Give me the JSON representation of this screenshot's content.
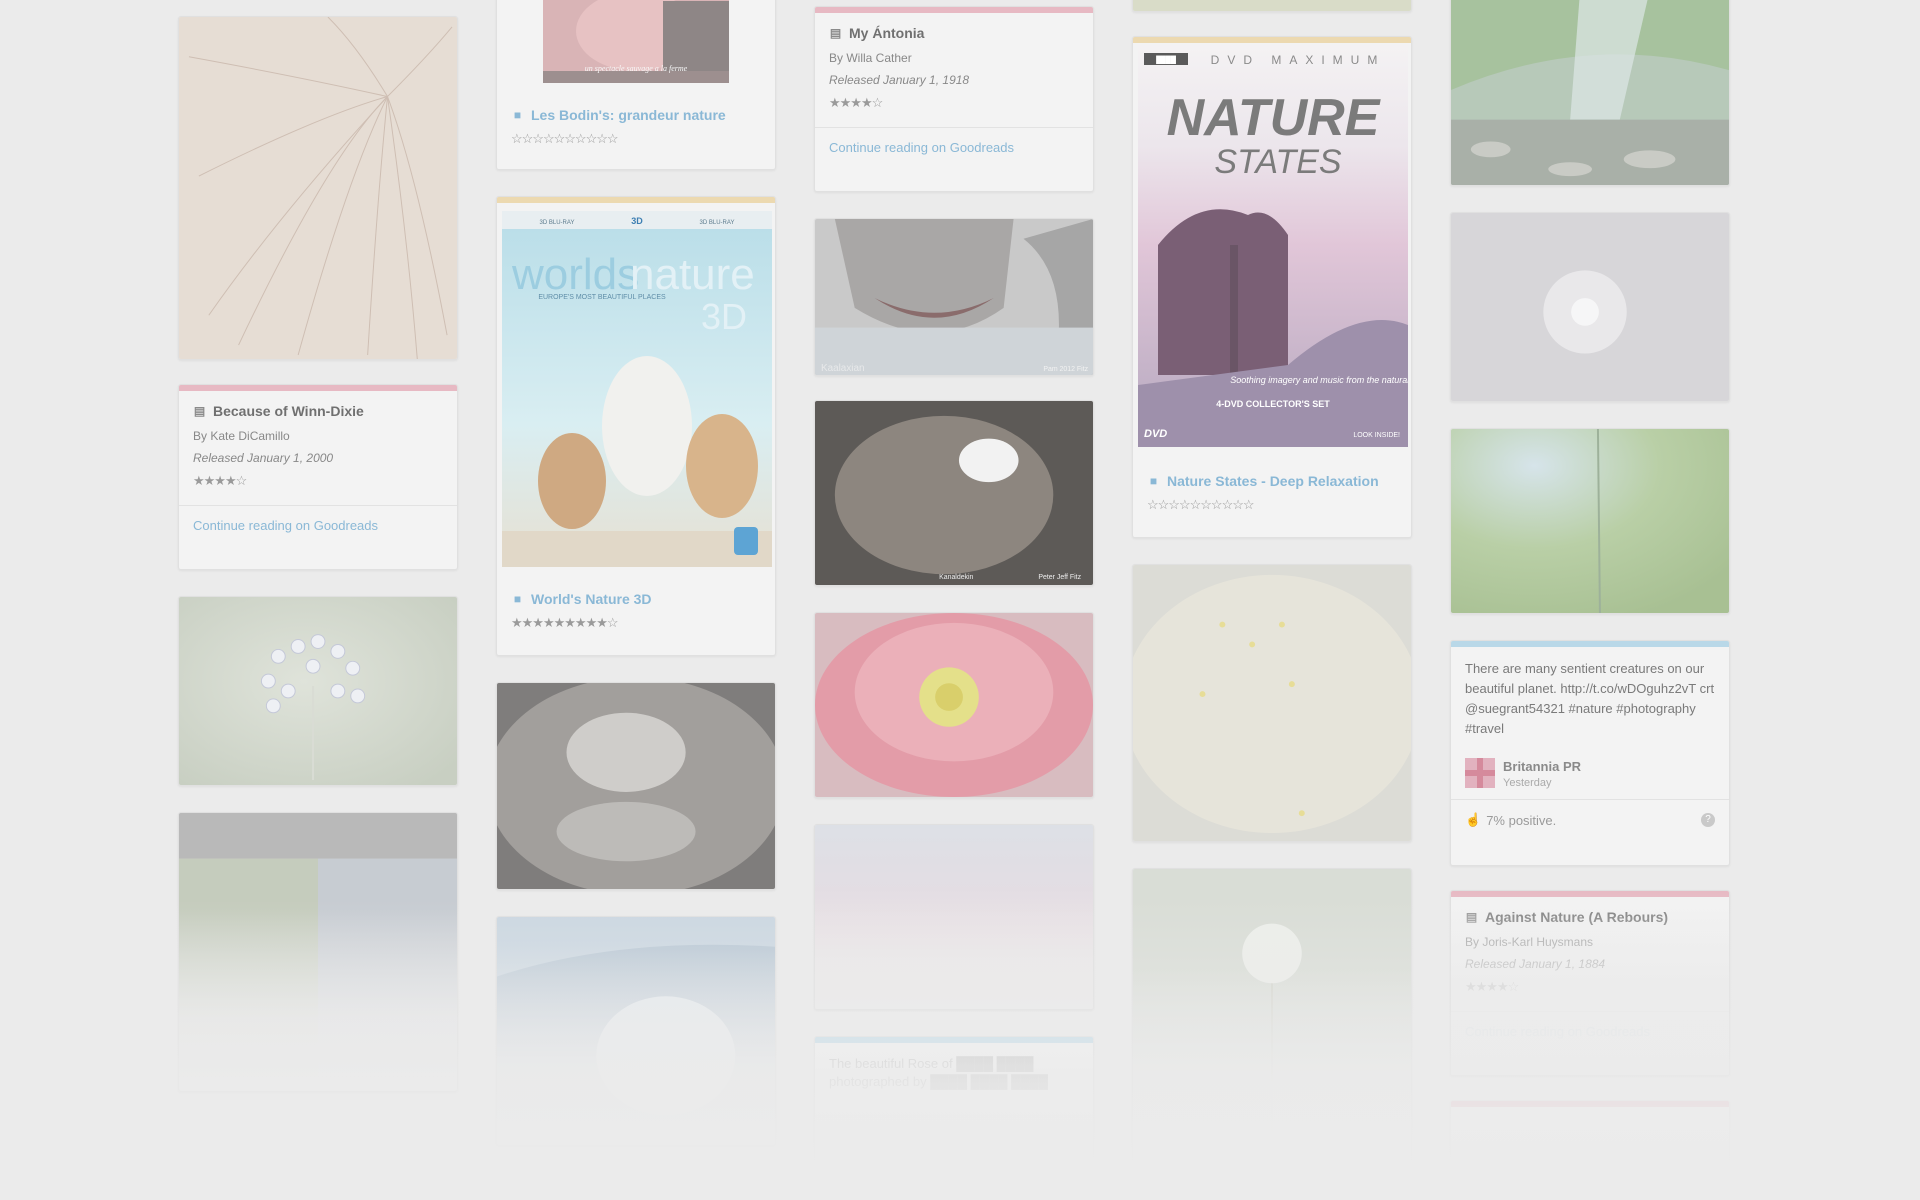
{
  "cards": {
    "winn_dixie": {
      "title": "Because of Winn-Dixie",
      "author": "By Kate DiCamillo",
      "released": "Released January 1, 2000",
      "stars": "★★★★☆",
      "link": "Continue reading on Goodreads"
    },
    "les_bodin": {
      "title": "Les Bodin's: grandeur nature",
      "stars": "☆☆☆☆☆☆☆☆☆☆",
      "poster_text": "un spectacle sauvage a la ferme"
    },
    "worlds_nature": {
      "title": "World's Nature 3D",
      "stars": "★★★★★★★★★☆",
      "poster_top_left": "3D BLU-RAY",
      "poster_top_badge": "3D",
      "poster_top_right": "3D BLU-RAY",
      "poster_title_a": "worlds",
      "poster_title_b": "nature",
      "poster_subtitle": "EUROPE'S MOST BEAUTIFUL PLACES",
      "poster_3d": "3D"
    },
    "my_antonia": {
      "title": "My Ántonia",
      "author": "By Willa Cather",
      "released": "Released January 1, 1918",
      "stars": "★★★★☆",
      "link": "Continue reading on Goodreads"
    },
    "nature_states": {
      "title": "Nature States - Deep Relaxation",
      "stars": "☆☆☆☆☆☆☆☆☆☆",
      "poster_header": "DVD MAXIMUM",
      "poster_brand": "████",
      "poster_title_1": "NATURE",
      "poster_title_2": "STATES",
      "poster_tagline": "Soothing imagery and music from the natural world.",
      "poster_footer": "4-DVD COLLECTOR'S SET",
      "poster_dvd": "DVD",
      "poster_look": "LOOK INSIDE!"
    },
    "tweet": {
      "text": "There are many sentient creatures on our beautiful planet. http://t.co/wDOguhz2vT crt @suegrant54321 #nature #photography #travel",
      "user": "Britannia PR",
      "time": "Yesterday",
      "positive": "7% positive."
    },
    "against_nature": {
      "title": "Against Nature (A Rebours)",
      "author": "By Joris-Karl Huysmans",
      "released": "Released January 1, 1884",
      "stars": "★★★★☆",
      "link": "Continue reading on Goodreads"
    },
    "faded_tweet": {
      "text": "The beautiful Rose of ████ ████ photographed by ████ ████ ████"
    },
    "shark_photo": {
      "credit_left": "Kaalaxian",
      "credit_right": "Pam 2012 Fitz"
    },
    "cave_photo": {
      "credit_left": "Kanaldekin",
      "credit_right": "Peter Jeff Fitz"
    }
  },
  "colors": {
    "background": "#ebebeb",
    "card": "#f3f3f3",
    "link": "#8ab8d6",
    "bar_pink": "#e7b9c3",
    "bar_gold": "#ecd9b0",
    "bar_blue": "#b9d8e8"
  }
}
